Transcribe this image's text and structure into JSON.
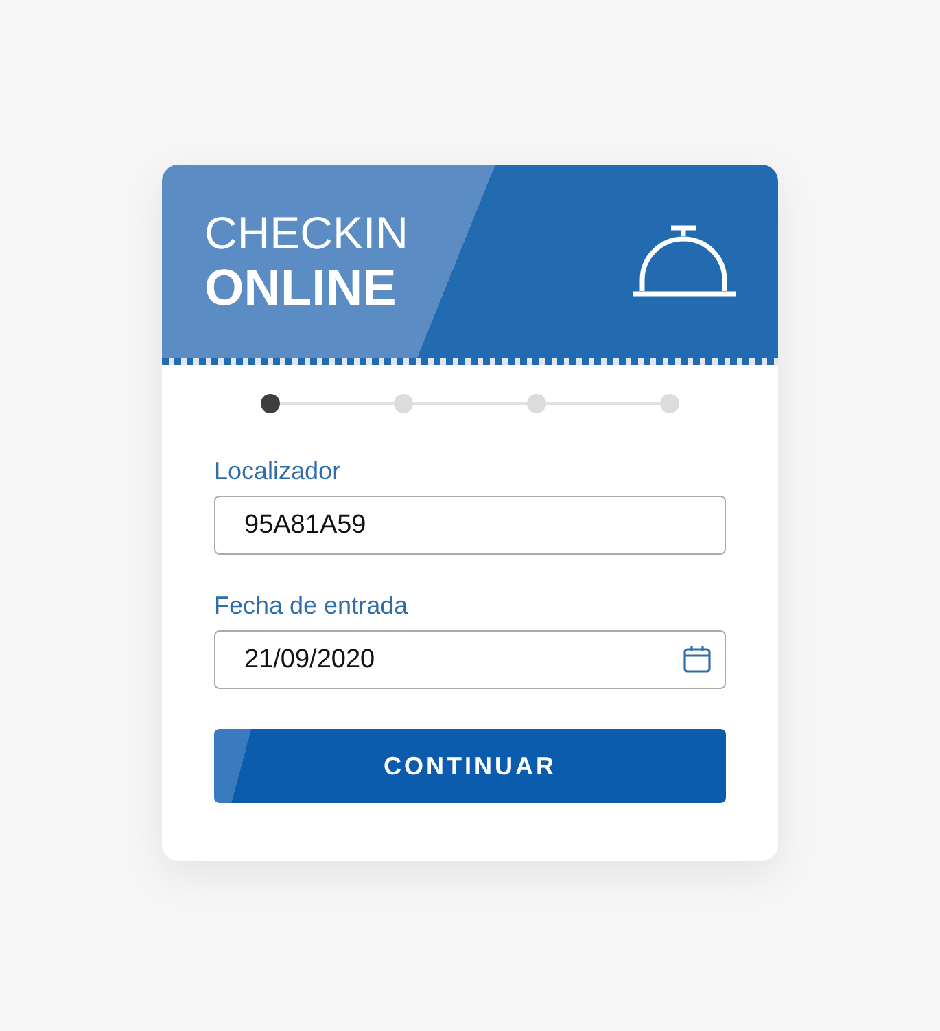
{
  "header": {
    "title_light": "CHECKIN",
    "title_bold": "ONLINE"
  },
  "steps": [
    {
      "selected": true
    },
    {
      "selected": false
    },
    {
      "selected": false
    },
    {
      "selected": false
    }
  ],
  "fields": [
    {
      "kind": "text",
      "label": "Localizador",
      "value": "95A81A59"
    },
    {
      "kind": "date",
      "label": "Fecha de entrada",
      "value": "21/09/2020"
    }
  ],
  "button": {
    "label": "CONTINUAR"
  }
}
